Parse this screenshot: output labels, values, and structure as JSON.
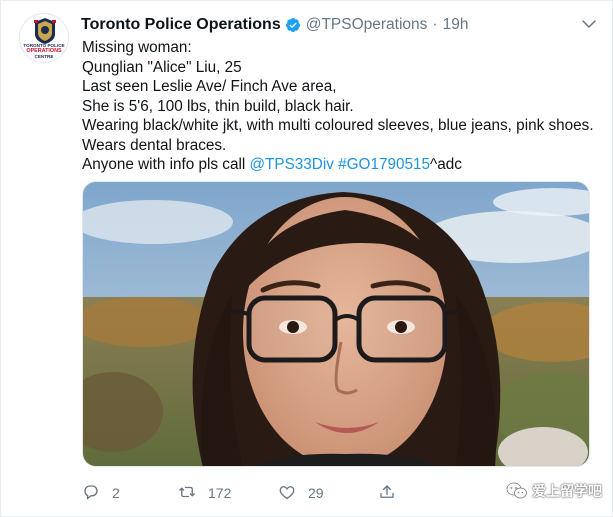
{
  "tweet": {
    "author": {
      "display_name": "Toronto Police Operations",
      "handle": "@TPSOperations",
      "time": "19h",
      "verified": true,
      "avatar_text_line1": "TORONTO POLICE",
      "avatar_text_line2": "OPERATIONS",
      "avatar_text_line3": "CENTRE"
    },
    "separator": "·",
    "body": {
      "line1": "Missing woman:",
      "line2": "Qunglian \"Alice\" Liu, 25",
      "line3": "Last seen Leslie Ave/ Finch Ave area,",
      "line4": "She is 5'6, 100 lbs, thin build, black hair.",
      "line5": "Wearing black/white jkt, with multi coloured sleeves, blue jeans, pink shoes.",
      "line6": "Wears dental braces.",
      "line7_prefix": "Anyone with info pls call ",
      "mention": "@TPS33Div",
      "hashtag": "#GO1790515",
      "line7_suffix": "^adc"
    },
    "actions": {
      "reply_count": "2",
      "retweet_count": "172",
      "like_count": "29"
    },
    "icons": {
      "reply": "reply-icon",
      "retweet": "retweet-icon",
      "like": "heart-icon",
      "share": "share-icon",
      "menu": "chevron-down-icon",
      "verified": "verified-badge-icon"
    },
    "colors": {
      "link": "#1b95e0",
      "muted": "#657786",
      "verified": "#1da1f2"
    }
  },
  "watermark": {
    "text": "爱上留学吧"
  }
}
